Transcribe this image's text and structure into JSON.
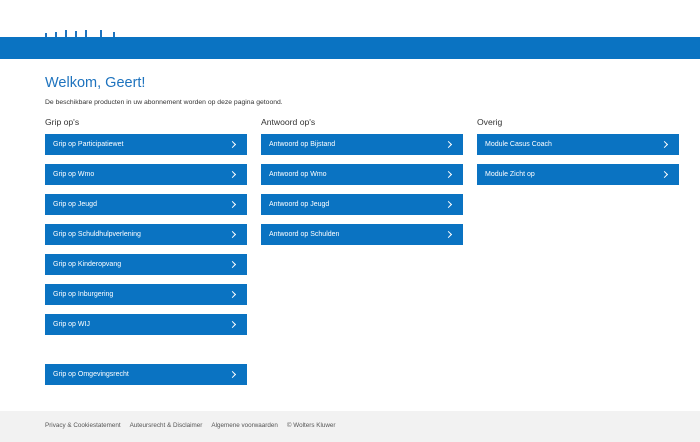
{
  "header": {
    "brand_color": "#0a73c2"
  },
  "welcome": {
    "title": "Welkom, Geert!",
    "intro": "De beschikbare producten in uw abonnement worden op deze pagina getoond."
  },
  "columns": [
    {
      "title": "Grip op's",
      "items": [
        "Grip op Participatiewet",
        "Grip op Wmo",
        "Grip op Jeugd",
        "Grip op Schuldhulpverlening",
        "Grip op Kinderopvang",
        "Grip op Inburgering",
        "Grip op WIJ",
        "Grip op Omgevingsrecht"
      ]
    },
    {
      "title": "Antwoord op's",
      "items": [
        "Antwoord op Bijstand",
        "Antwoord op Wmo",
        "Antwoord op Jeugd",
        "Antwoord op Schulden"
      ]
    },
    {
      "title": "Overig",
      "items": [
        "Module Casus Coach",
        "Module Zicht op"
      ]
    }
  ],
  "footer": {
    "links": [
      "Privacy & Cookiestatement",
      "Auteursrecht & Disclaimer",
      "Algemene voorwaarden",
      "© Wolters Kluwer"
    ]
  },
  "icons": {
    "button_icon": "chevron-right-icon"
  }
}
